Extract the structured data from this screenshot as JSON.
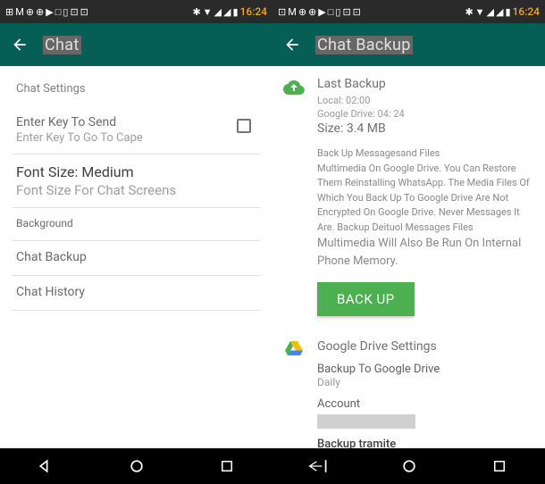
{
  "status": {
    "time": "16:24"
  },
  "left": {
    "title": "Chat",
    "section_head": "Chat Settings",
    "enter_key": {
      "title": "Enter Key To Send",
      "sub": "Enter Key To Go To Cape"
    },
    "font_size": {
      "title": "Font Size: Medium",
      "sub": "Font Size For Chat Screens"
    },
    "background": "Background",
    "chat_backup": "Chat Backup",
    "chat_history": "Chat History"
  },
  "right": {
    "title": "Chat Backup",
    "last_backup": {
      "head": "Last Backup",
      "local": "Local: 02:00",
      "gdrive": "Google Drive: 04: 24",
      "size": "Size: 3.4 MB"
    },
    "desc_line1": "Back Up Messagesand Files",
    "desc_body": "Multimedia On Google Drive. You Can Restore Them Reinstalling WhatsApp. The Media Files Of Which You Back Up To Google Drive Are Not Encrypted On Google Drive. Never Messages It Are. Backup Deituol Messages Files",
    "desc_tail": "Multimedia Will Also Be Run On Internal Phone Memory.",
    "backup_btn": "BACK UP",
    "gdrive_settings": {
      "head": "Google Drive Settings",
      "backup_to": "Backup To Google Drive",
      "freq": "Daily",
      "account": "Account",
      "via": "Backup tramite"
    }
  }
}
